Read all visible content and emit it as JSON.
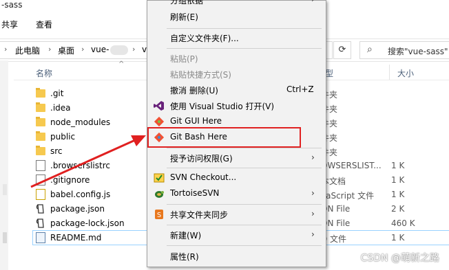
{
  "window": {
    "title_fragment": "-sass"
  },
  "ribbon": {
    "share_label": "共享",
    "view_label": "查看"
  },
  "address": {
    "crumbs": [
      "此电脑",
      "桌面",
      "vue-",
      "v"
    ],
    "refresh_glyph": "⟳",
    "search_placeholder": "搜索\"vue-sass\""
  },
  "columns": {
    "name": "名称",
    "type": "型",
    "size": "大小"
  },
  "files": [
    {
      "name": ".git",
      "kind": "folder",
      "type": "件夹",
      "size": ""
    },
    {
      "name": ".idea",
      "kind": "folder",
      "type": "件夹",
      "size": ""
    },
    {
      "name": "node_modules",
      "kind": "folder",
      "type": "件夹",
      "size": ""
    },
    {
      "name": "public",
      "kind": "folder",
      "type": "件夹",
      "size": ""
    },
    {
      "name": "src",
      "kind": "folder",
      "type": "件夹",
      "size": ""
    },
    {
      "name": ".browserslistrc",
      "kind": "file",
      "type": "OWSERSLIST...",
      "size": "1 K"
    },
    {
      "name": ".gitignore",
      "kind": "file",
      "type": "本文档",
      "size": "1 K"
    },
    {
      "name": "babel.config.js",
      "kind": "js",
      "type": "vaScript 文件",
      "size": "1 K"
    },
    {
      "name": "package.json",
      "kind": "json",
      "type": "ON File",
      "size": "2 K"
    },
    {
      "name": "package-lock.json",
      "kind": "json",
      "type": "ON File",
      "size": "460 K"
    },
    {
      "name": "README.md",
      "kind": "md",
      "type": "D 文件",
      "size": "1 K"
    }
  ],
  "menu": {
    "top_partial": "分组依据",
    "refresh": "刷新(E)",
    "customize": "自定义文件夹(F)...",
    "paste": "粘贴(P)",
    "paste_shortcut": "粘贴快捷方式(S)",
    "undo_delete": "撤消 删除(U)",
    "undo_shortcut": "Ctrl+Z",
    "open_vs": "使用 Visual Studio 打开(V)",
    "git_gui": "Git GUI Here",
    "git_bash": "Git Bash Here",
    "grant_access": "授予访问权限(G)",
    "svn_checkout": "SVN Checkout...",
    "tortoise": "TortoiseSVN",
    "share_sync": "共享文件夹同步",
    "new": "新建(W)",
    "properties": "属性(R)"
  },
  "watermark": "CSDN @萌新之路",
  "colors": {
    "highlight": "#e02020",
    "vs_purple": "#68217a",
    "git_orange": "#f05133"
  }
}
